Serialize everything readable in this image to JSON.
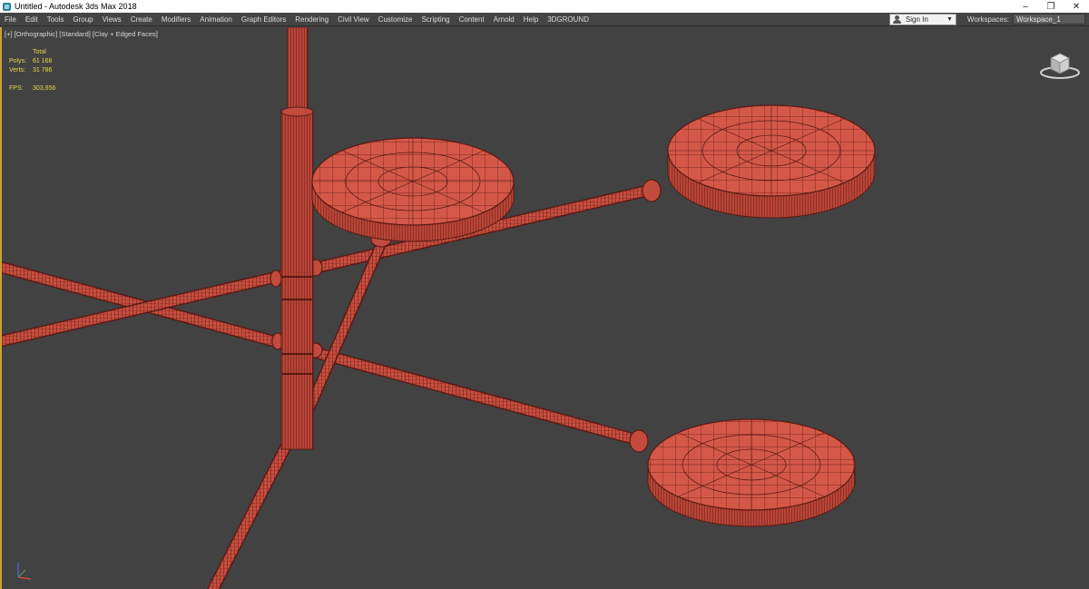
{
  "window": {
    "title": "Untitled - Autodesk 3ds Max 2018",
    "minimize": "–",
    "restore": "❐",
    "close": "✕"
  },
  "menu": {
    "items": [
      "File",
      "Edit",
      "Tools",
      "Group",
      "Views",
      "Create",
      "Modifiers",
      "Animation",
      "Graph Editors",
      "Rendering",
      "Civil View",
      "Customize",
      "Scripting",
      "Content",
      "Arnold",
      "Help",
      "3DGROUND"
    ],
    "sign_in": "Sign In",
    "workspaces_label": "Workspaces:",
    "workspace_value": "Workspace_1"
  },
  "viewport": {
    "label": "[+] [Orthographic] [Standard] [Clay + Edged Faces]",
    "stats": {
      "header": "Total",
      "polys_label": "Polys:",
      "polys_value": "61 168",
      "verts_label": "Verts:",
      "verts_value": "31 786",
      "fps_label": "FPS:",
      "fps_value": "303,656"
    }
  },
  "colors": {
    "model_fill": "#d45848",
    "model_wire": "#5a1a14",
    "viewport_bg": "#424242",
    "stats_text": "#e3d84a",
    "active_border": "#c9a23a"
  },
  "icons": {
    "app": "3dsmax-app-icon",
    "viewcube": "viewcube-icon",
    "axis": "axis-tripod-icon",
    "user": "user-icon"
  }
}
